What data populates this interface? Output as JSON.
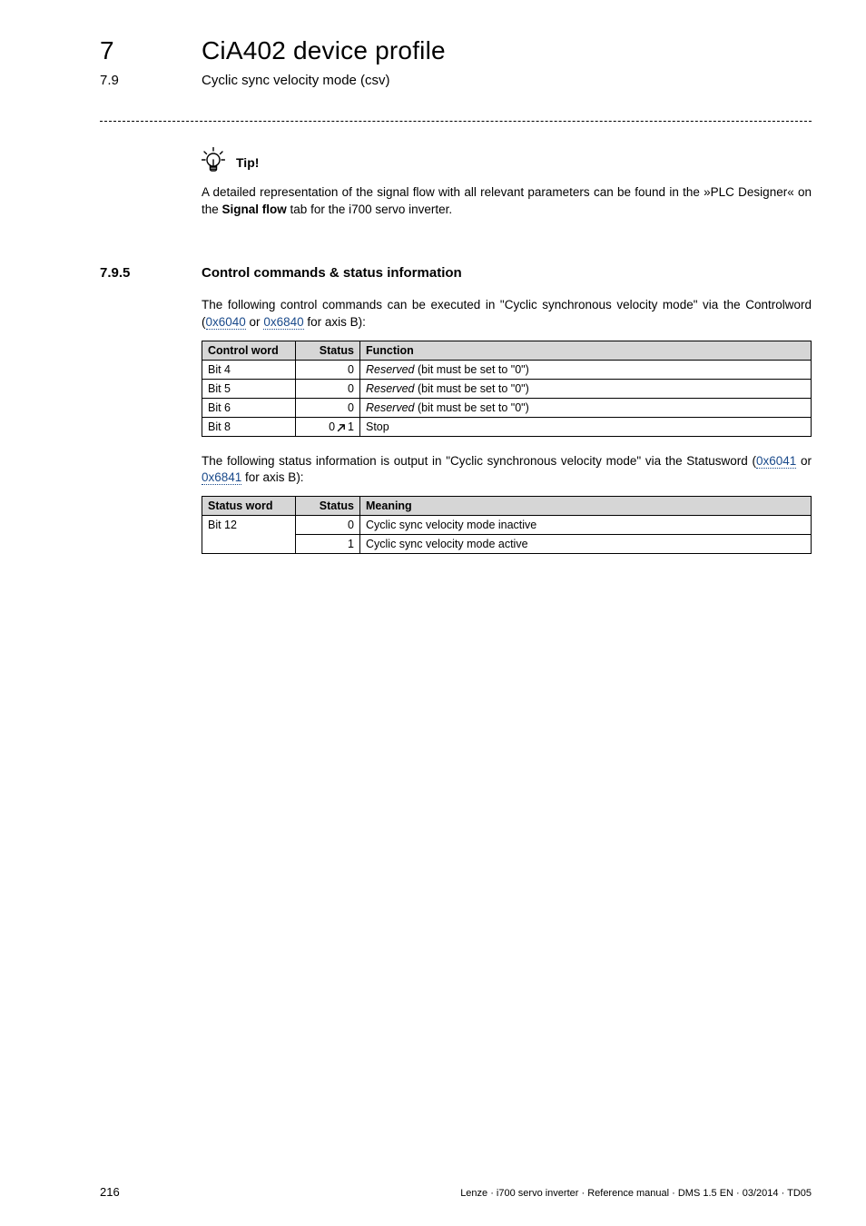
{
  "header": {
    "chapter_number": "7",
    "chapter_title": "CiA402 device profile",
    "subsection_number": "7.9",
    "subsection_title": "Cyclic sync velocity mode (csv)"
  },
  "tip": {
    "label": "Tip!",
    "text_a": "A detailed representation of the signal flow with all relevant parameters can be found in the »PLC Designer« on the ",
    "bold": "Signal flow",
    "text_b": " tab for the i700 servo inverter."
  },
  "section": {
    "number": "7.9.5",
    "title": "Control commands & status information"
  },
  "p1": {
    "a": "The following control commands can be executed in \"Cyclic synchronous velocity mode\" via the Controlword (",
    "link1": "0x6040",
    "mid": " or ",
    "link2": "0x6840",
    "b": " for axis B):"
  },
  "table1": {
    "headers": {
      "word": "Control word",
      "status": "Status",
      "function": "Function"
    },
    "rows": [
      {
        "word": "Bit 4",
        "status": "0",
        "func_italic": "Reserved",
        "func_rest": " (bit must be set to \"0\")"
      },
      {
        "word": "Bit 5",
        "status": "0",
        "func_italic": "Reserved",
        "func_rest": " (bit must be set to \"0\")"
      },
      {
        "word": "Bit 6",
        "status": "0",
        "func_italic": "Reserved",
        "func_rest": " (bit must be set to \"0\")"
      },
      {
        "word": "Bit 8",
        "status_a": "0 ",
        "status_b": " 1",
        "func_rest": "Stop"
      }
    ]
  },
  "p2": {
    "a": "The following status information is output in \"Cyclic synchronous velocity mode\" via the Statusword (",
    "link1": "0x6041",
    "mid": " or ",
    "link2": "0x6841",
    "b": " for axis B):"
  },
  "table2": {
    "headers": {
      "word": "Status word",
      "status": "Status",
      "meaning": "Meaning"
    },
    "rows": [
      {
        "word": "Bit 12",
        "status": "0",
        "meaning": "Cyclic sync velocity mode inactive"
      },
      {
        "word": "",
        "status": "1",
        "meaning": "Cyclic sync velocity mode active"
      }
    ]
  },
  "footer": {
    "page": "216",
    "info": "Lenze · i700 servo inverter · Reference manual · DMS 1.5 EN · 03/2014 · TD05"
  }
}
